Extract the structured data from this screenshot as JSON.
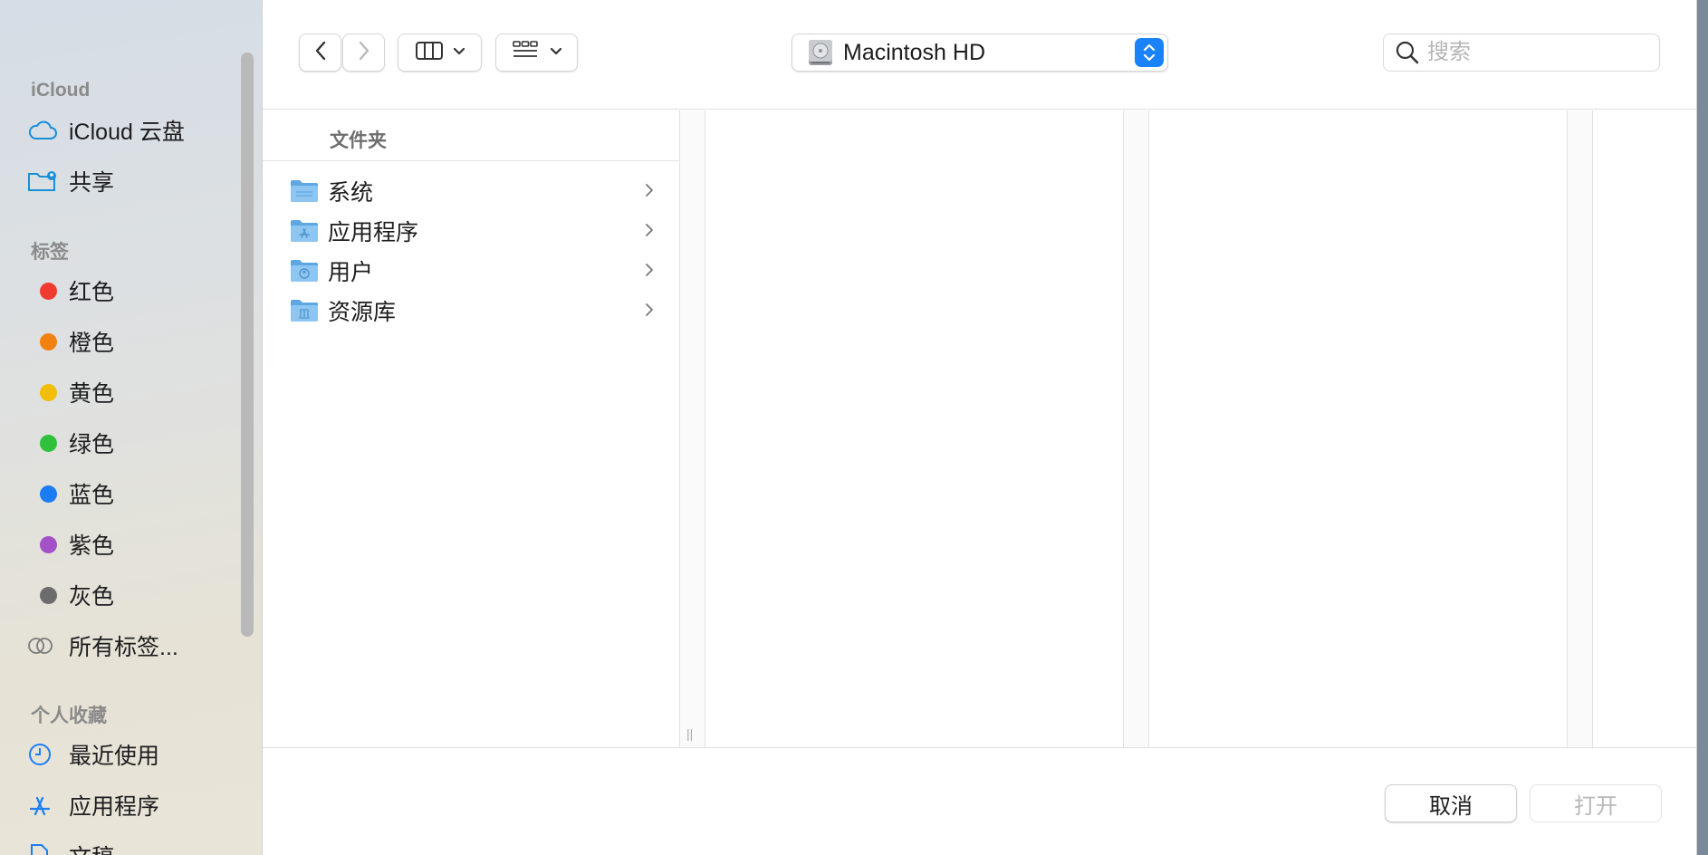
{
  "sidebar": {
    "sections": [
      {
        "id": "icloud",
        "title": "iCloud"
      },
      {
        "id": "tags",
        "title": "标签"
      },
      {
        "id": "favorites",
        "title": "个人收藏"
      }
    ],
    "icloud_items": [
      {
        "label": "iCloud 云盘",
        "icon": "cloud-icon"
      },
      {
        "label": "共享",
        "icon": "shared-folder-icon"
      }
    ],
    "tags": [
      {
        "label": "红色",
        "color": "#f23b30"
      },
      {
        "label": "橙色",
        "color": "#f2820f"
      },
      {
        "label": "黄色",
        "color": "#f3bd0b"
      },
      {
        "label": "绿色",
        "color": "#2fc03c"
      },
      {
        "label": "蓝色",
        "color": "#1c7cf3"
      },
      {
        "label": "紫色",
        "color": "#a450c7"
      },
      {
        "label": "灰色",
        "color": "#6c6c6c"
      },
      {
        "label": "所有标签...",
        "icon": "all-tags-icon"
      }
    ],
    "favorites": [
      {
        "label": "最近使用",
        "icon": "clock-icon"
      },
      {
        "label": "应用程序",
        "icon": "app-store-icon"
      },
      {
        "label": "文稿",
        "icon": "document-icon"
      }
    ]
  },
  "toolbar": {
    "location": "Macintosh HD",
    "search_placeholder": "搜索"
  },
  "browser": {
    "column_header": "文件夹",
    "items": [
      {
        "name": "系统"
      },
      {
        "name": "应用程序"
      },
      {
        "name": "用户"
      },
      {
        "name": "资源库"
      }
    ]
  },
  "buttons": {
    "cancel": "取消",
    "open": "打开"
  }
}
